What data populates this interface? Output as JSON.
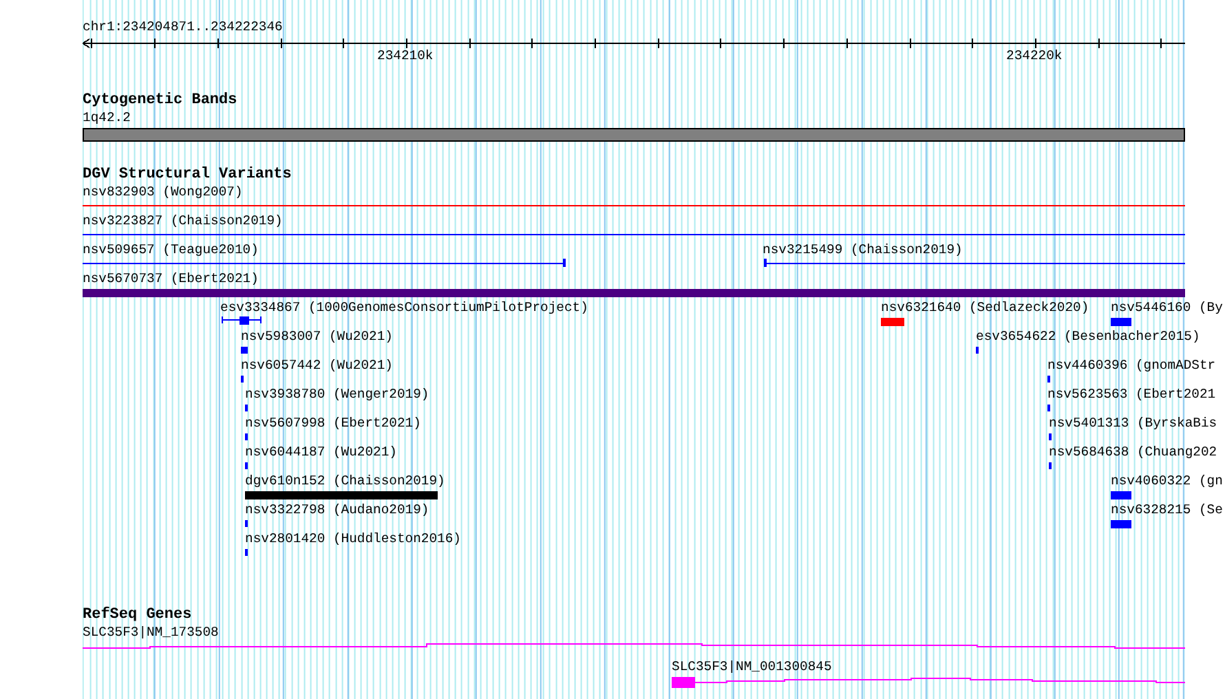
{
  "ruler": {
    "location": "chr1:234204871..234222346",
    "tick_labels": [
      "234210k",
      "234220k"
    ]
  },
  "tracks": [
    {
      "title": "Cytogenetic Bands",
      "kind": "bands",
      "features": [
        {
          "label": "1q42.2",
          "color": "#808080"
        }
      ]
    },
    {
      "title": "DGV Structural Variants",
      "kind": "variants",
      "features": [
        {
          "label": "nsv832903 (Wong2007)",
          "kind": "line",
          "color": "#ff0000"
        },
        {
          "label": "nsv3223827 (Chaisson2019)",
          "kind": "line",
          "color": "#0000ff"
        },
        {
          "label": "nsv509657 (Teague2010)",
          "kind": "line",
          "color": "#0000ff"
        },
        {
          "label": "nsv3215499 (Chaisson2019)",
          "kind": "line",
          "color": "#0000ff"
        },
        {
          "label": "nsv5670737 (Ebert2021)",
          "kind": "bar",
          "color": "#4b0082"
        },
        {
          "label": "esv3334867 (1000GenomesConsortiumPilotProject)",
          "kind": "span",
          "color": "#0000ff"
        },
        {
          "label": "nsv6321640 (Sedlazeck2020)",
          "kind": "bar",
          "color": "#ff0000"
        },
        {
          "label": "nsv5446160 (By",
          "kind": "bar",
          "color": "#0000ff"
        },
        {
          "label": "nsv5983007 (Wu2021)",
          "kind": "bar",
          "color": "#0000ff"
        },
        {
          "label": "esv3654622 (Besenbacher2015)",
          "kind": "bar",
          "color": "#0000ff"
        },
        {
          "label": "nsv6057442 (Wu2021)",
          "kind": "bar",
          "color": "#0000ff"
        },
        {
          "label": "nsv4460396 (gnomADStr",
          "kind": "bar",
          "color": "#0000ff"
        },
        {
          "label": "nsv3938780 (Wenger2019)",
          "kind": "bar",
          "color": "#0000ff"
        },
        {
          "label": "nsv5623563 (Ebert2021",
          "kind": "bar",
          "color": "#0000ff"
        },
        {
          "label": "nsv5607998 (Ebert2021)",
          "kind": "bar",
          "color": "#0000ff"
        },
        {
          "label": "nsv5401313 (ByrskaBis",
          "kind": "bar",
          "color": "#0000ff"
        },
        {
          "label": "nsv6044187 (Wu2021)",
          "kind": "bar",
          "color": "#0000ff"
        },
        {
          "label": "nsv5684638 (Chuang202",
          "kind": "bar",
          "color": "#0000ff"
        },
        {
          "label": "dgv610n152 (Chaisson2019)",
          "kind": "bar",
          "color": "#000000"
        },
        {
          "label": "nsv4060322 (gn",
          "kind": "bar",
          "color": "#0000ff"
        },
        {
          "label": "nsv3322798 (Audano2019)",
          "kind": "bar",
          "color": "#0000ff"
        },
        {
          "label": "nsv6328215 (Se",
          "kind": "bar",
          "color": "#0000ff"
        },
        {
          "label": "nsv2801420 (Huddleston2016)",
          "kind": "bar",
          "color": "#0000ff"
        }
      ]
    },
    {
      "title": "RefSeq Genes",
      "kind": "genes",
      "features": [
        {
          "label": "SLC35F3|NM_173508",
          "color": "#ff00ff"
        },
        {
          "label": "SLC35F3|NM_001300845",
          "color": "#ff00ff"
        }
      ]
    }
  ]
}
